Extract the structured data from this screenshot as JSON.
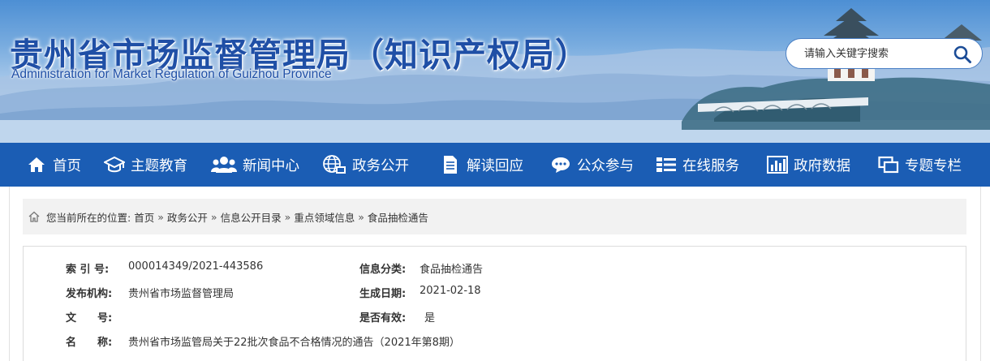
{
  "header": {
    "title": "贵州省市场监督管理局（知识产权局）",
    "subtitle": "Administration for Market Regulation of Guizhou Province"
  },
  "search": {
    "placeholder": "请输入关键字搜索",
    "icon": "search-icon"
  },
  "nav": {
    "items": [
      {
        "label": "首页",
        "icon": "home-icon"
      },
      {
        "label": "主题教育",
        "icon": "graduation-cap-icon"
      },
      {
        "label": "新闻中心",
        "icon": "users-icon"
      },
      {
        "label": "政务公开",
        "icon": "globe-icon"
      },
      {
        "label": "解读回应",
        "icon": "document-icon"
      },
      {
        "label": "公众参与",
        "icon": "chat-bubble-icon"
      },
      {
        "label": "在线服务",
        "icon": "list-icon"
      },
      {
        "label": "政府数据",
        "icon": "bar-chart-icon"
      },
      {
        "label": "专题专栏",
        "icon": "windows-icon"
      }
    ]
  },
  "breadcrumb": {
    "prefix": "您当前所在的位置:",
    "items": [
      "首页",
      "政务公开",
      "信息公开目录",
      "重点领域信息",
      "食品抽检通告"
    ],
    "separator": "»"
  },
  "meta": {
    "index_label": "索 引 号:",
    "index_value": "000014349/2021-443586",
    "category_label": "信息分类:",
    "category_value": "食品抽检通告",
    "publisher_label": "发布机构:",
    "publisher_value": "贵州省市场监督管理局",
    "date_label": "生成日期:",
    "date_value": "2021-02-18",
    "docno_label": "文　　号:",
    "docno_value": "",
    "valid_label": "是否有效:",
    "valid_value": "是",
    "name_label": "名　　称:",
    "name_value": "贵州省市场监管局关于22批次食品不合格情况的通告（2021年第8期）"
  },
  "colors": {
    "nav_bg": "#1b5db4",
    "title": "#1f4fa6",
    "breadcrumb_bg": "#f2f2f2"
  }
}
